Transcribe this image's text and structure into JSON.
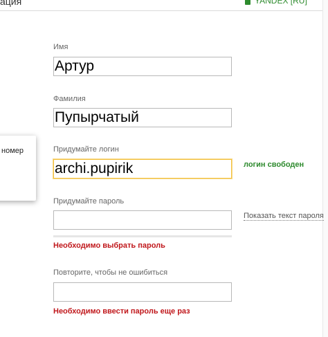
{
  "browser": {
    "tab_title": "ация",
    "secure_label": "YANDEX [RU]"
  },
  "popup": {
    "text": "номер"
  },
  "form": {
    "first_name": {
      "label": "Имя",
      "value": "Артур"
    },
    "last_name": {
      "label": "Фамилия",
      "value": "Пупырчатый"
    },
    "login": {
      "label": "Придумайте логин",
      "value": "archi.pupirik",
      "status": "логин свободен"
    },
    "password": {
      "label": "Придумайте пароль",
      "value": "",
      "show_link": "Показать текст пароля",
      "error": "Необходимо выбрать пароль"
    },
    "password_repeat": {
      "label": "Повторите, чтобы не ошибиться",
      "value": "",
      "error": "Необходимо ввести пароль еще раз"
    }
  },
  "colors": {
    "error": "#c0171b",
    "success": "#2d8a2d",
    "focus": "#f3c13f"
  }
}
